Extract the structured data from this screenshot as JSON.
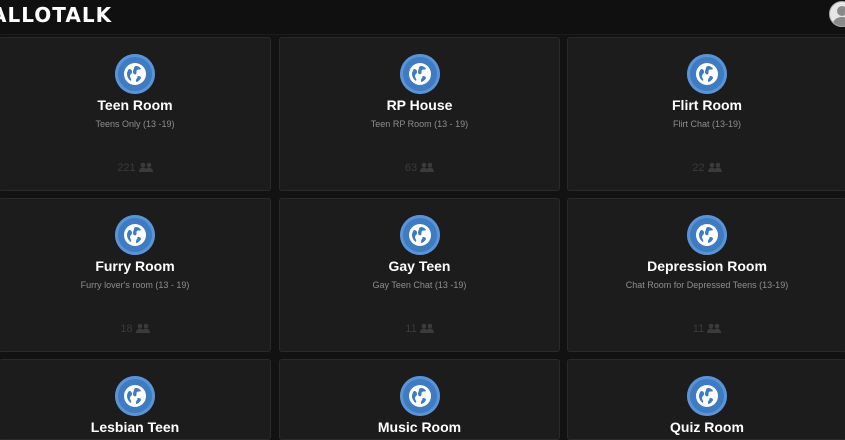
{
  "app": {
    "logo": "ALLOTALK"
  },
  "rooms": [
    {
      "name": "Teen Room",
      "description": "Teens Only (13 -19)",
      "users": "221"
    },
    {
      "name": "RP House",
      "description": "Teen RP Room (13 - 19)",
      "users": "63"
    },
    {
      "name": "Flirt Room",
      "description": "Flirt Chat (13-19)",
      "users": "22"
    },
    {
      "name": "Furry Room",
      "description": "Furry lover's room (13 - 19)",
      "users": "18"
    },
    {
      "name": "Gay Teen",
      "description": "Gay Teen Chat (13 -19)",
      "users": "11"
    },
    {
      "name": "Depression Room",
      "description": "Chat Room for Depressed Teens (13-19)",
      "users": "11"
    },
    {
      "name": "Lesbian Teen",
      "description": "",
      "users": ""
    },
    {
      "name": "Music Room",
      "description": "",
      "users": ""
    },
    {
      "name": "Quiz Room",
      "description": "",
      "users": ""
    }
  ],
  "icons": {
    "room": "globe-icon",
    "users": "users-icon",
    "account": "avatar-icon"
  },
  "colors": {
    "background": "#121212",
    "card": "#1c1c1c",
    "globe": "#3e7bc1",
    "title": "#ffffff",
    "description": "#8e8e8e",
    "count": "#3b3b3b"
  }
}
